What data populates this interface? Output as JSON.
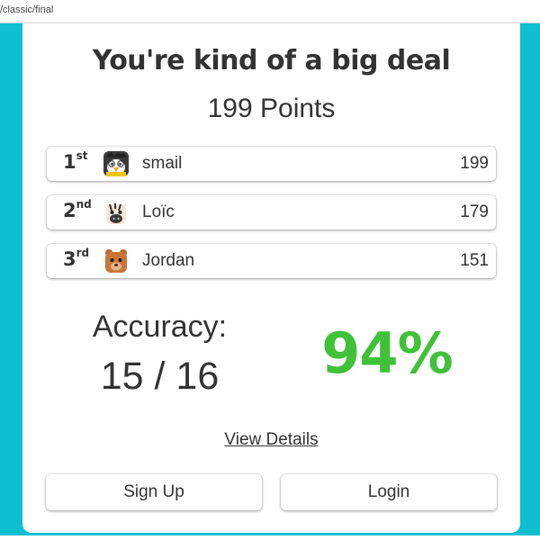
{
  "browser": {
    "url_fragment": "/classic/final"
  },
  "result": {
    "title": "You're kind of a big deal",
    "points_label": "199 Points"
  },
  "leaderboard": [
    {
      "rank_num": "1",
      "rank_suffix": "st",
      "name": "smail",
      "score": "199",
      "avatar_icon": "penguin-avatar-icon"
    },
    {
      "rank_num": "2",
      "rank_suffix": "nd",
      "name": "Loïc",
      "score": "179",
      "avatar_icon": "zebra-avatar-icon"
    },
    {
      "rank_num": "3",
      "rank_suffix": "rd",
      "name": "Jordan",
      "score": "151",
      "avatar_icon": "bear-avatar-icon"
    }
  ],
  "accuracy": {
    "label": "Accuracy:",
    "fraction": "15 / 16",
    "percent": "94%"
  },
  "links": {
    "view_details": "View Details"
  },
  "buttons": {
    "signup": "Sign Up",
    "login": "Login"
  },
  "colors": {
    "background": "#0fbfcf",
    "accuracy_green": "#3fc138",
    "text": "#333333"
  }
}
